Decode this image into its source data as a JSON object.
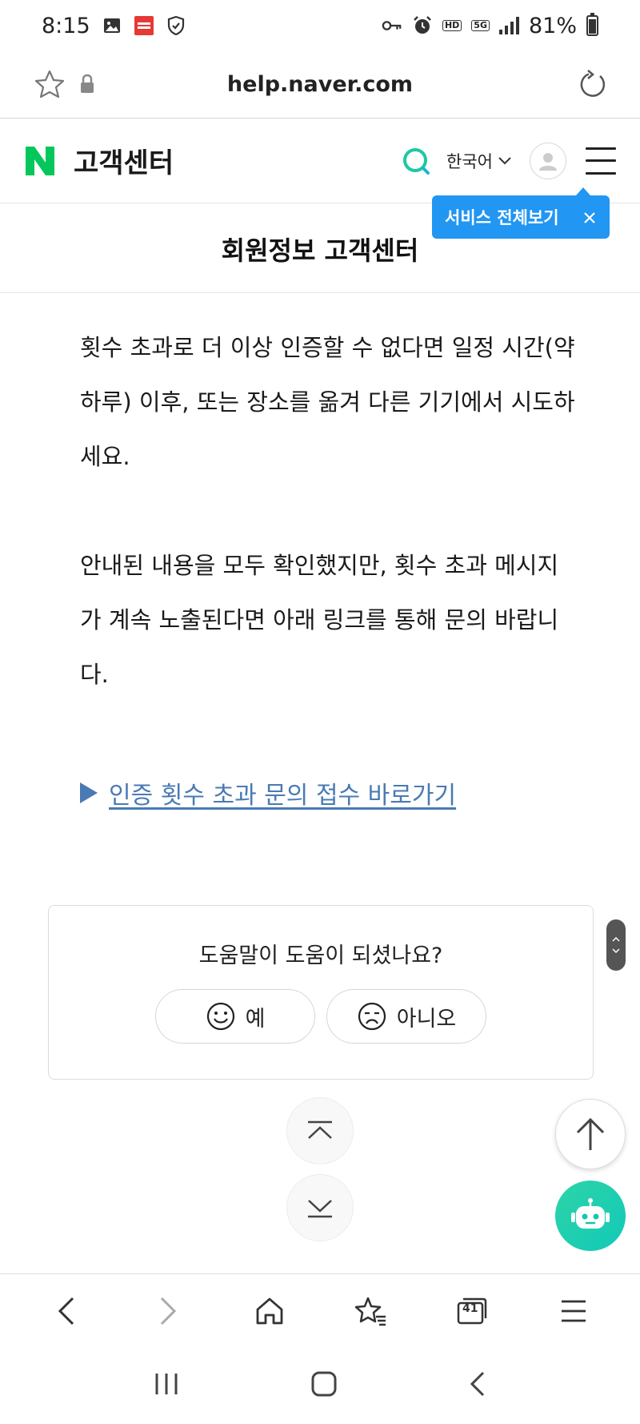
{
  "status_bar": {
    "time": "8:15",
    "battery": "81%",
    "battery_level": 0.81,
    "hd_label": "HD",
    "network_label": "5G"
  },
  "browser": {
    "url": "help.naver.com",
    "tab_count": "41"
  },
  "header": {
    "title": "고객센터",
    "language": "한국어",
    "brand_color": "#03c75a"
  },
  "tooltip": {
    "label": "서비스 전체보기",
    "color": "#2196f3"
  },
  "page": {
    "title": "회원정보 고객센터"
  },
  "content": {
    "paragraph1": "횟수 초과로 더 이상 인증할 수 없다면 일정 시간(약 하루) 이후, 또는 장소를 옮겨 다른 기기에서 시도하세요.",
    "paragraph2": "안내된 내용을 모두 확인했지만, 횟수 초과 메시지가 계속 노출된다면 아래 링크를 통해 문의 바랍니다.",
    "link_text": "인증 횟수 초과 문의 접수 바로가기",
    "link_color": "#4a7ab3"
  },
  "feedback": {
    "question": "도움말이 도움이 되셨나요?",
    "yes_label": "예",
    "no_label": "아니오"
  },
  "icons": {
    "status": [
      "gallery-icon",
      "app-notification-icon",
      "shield-icon",
      "key-icon",
      "alarm-icon",
      "signal-icon",
      "battery-icon"
    ],
    "browser_bottom": [
      "back-icon",
      "forward-icon",
      "home-icon",
      "bookmarks-icon",
      "tabs-icon",
      "menu-icon"
    ],
    "android_nav": [
      "recents-icon",
      "home-icon",
      "back-icon"
    ]
  }
}
